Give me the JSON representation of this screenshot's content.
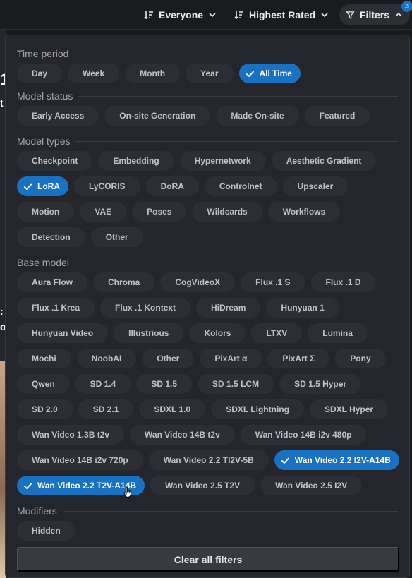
{
  "topbar": {
    "everyone_label": "Everyone",
    "sort_label": "Highest Rated",
    "filters_label": "Filters",
    "filters_count": "3"
  },
  "background": {
    "chars": [
      "1",
      "t",
      ":",
      "o"
    ]
  },
  "sections": [
    {
      "title": "Time period",
      "rows": [
        [
          {
            "label": "Day"
          },
          {
            "label": "Week"
          },
          {
            "label": "Month"
          },
          {
            "label": "Year"
          },
          {
            "label": "All Time",
            "selected": true
          }
        ]
      ]
    },
    {
      "title": "Model status",
      "rows": [
        [
          {
            "label": "Early Access"
          },
          {
            "label": "On-site Generation"
          },
          {
            "label": "Made On-site"
          },
          {
            "label": "Featured"
          }
        ]
      ]
    },
    {
      "title": "Model types",
      "rows": [
        [
          {
            "label": "Checkpoint"
          },
          {
            "label": "Embedding"
          },
          {
            "label": "Hypernetwork"
          },
          {
            "label": "Aesthetic Gradient"
          }
        ],
        [
          {
            "label": "LoRA",
            "selected": true
          },
          {
            "label": "LyCORIS"
          },
          {
            "label": "DoRA"
          },
          {
            "label": "Controlnet"
          },
          {
            "label": "Upscaler"
          }
        ],
        [
          {
            "label": "Motion"
          },
          {
            "label": "VAE"
          },
          {
            "label": "Poses"
          },
          {
            "label": "Wildcards"
          },
          {
            "label": "Workflows"
          }
        ],
        [
          {
            "label": "Detection"
          },
          {
            "label": "Other"
          }
        ]
      ]
    },
    {
      "title": "Base model",
      "rows": [
        [
          {
            "label": "Aura Flow"
          },
          {
            "label": "Chroma"
          },
          {
            "label": "CogVideoX"
          },
          {
            "label": "Flux .1 S"
          },
          {
            "label": "Flux .1 D"
          }
        ],
        [
          {
            "label": "Flux .1 Krea"
          },
          {
            "label": "Flux .1 Kontext"
          },
          {
            "label": "HiDream"
          },
          {
            "label": "Hunyuan 1"
          }
        ],
        [
          {
            "label": "Hunyuan Video"
          },
          {
            "label": "Illustrious"
          },
          {
            "label": "Kolors"
          },
          {
            "label": "LTXV"
          },
          {
            "label": "Lumina"
          }
        ],
        [
          {
            "label": "Mochi"
          },
          {
            "label": "NoobAI"
          },
          {
            "label": "Other"
          },
          {
            "label": "PixArt α"
          },
          {
            "label": "PixArt Σ"
          },
          {
            "label": "Pony"
          }
        ],
        [
          {
            "label": "Qwen"
          },
          {
            "label": "SD 1.4"
          },
          {
            "label": "SD 1.5"
          },
          {
            "label": "SD 1.5 LCM"
          },
          {
            "label": "SD 1.5 Hyper"
          }
        ],
        [
          {
            "label": "SD 2.0"
          },
          {
            "label": "SD 2.1"
          },
          {
            "label": "SDXL 1.0"
          },
          {
            "label": "SDXL Lightning"
          },
          {
            "label": "SDXL Hyper"
          }
        ],
        [
          {
            "label": "Wan Video 1.3B t2v"
          },
          {
            "label": "Wan Video 14B t2v"
          },
          {
            "label": "Wan Video 14B i2v 480p"
          }
        ],
        [
          {
            "label": "Wan Video 14B i2v 720p"
          },
          {
            "label": "Wan Video 2.2 TI2V-5B"
          },
          {
            "label": "Wan Video 2.2 I2V-A14B",
            "selected": true
          }
        ],
        [
          {
            "label": "Wan Video 2.2 T2V-A14B",
            "selected": true
          },
          {
            "label": "Wan Video 2.5 T2V"
          },
          {
            "label": "Wan Video 2.5 I2V"
          }
        ]
      ]
    },
    {
      "title": "Modifiers",
      "rows": [
        [
          {
            "label": "Hidden"
          }
        ]
      ]
    }
  ],
  "clear_label": "Clear all filters",
  "colors": {
    "accent": "#1971c2",
    "chip": "#2c2e33",
    "panel": "#25262b"
  }
}
